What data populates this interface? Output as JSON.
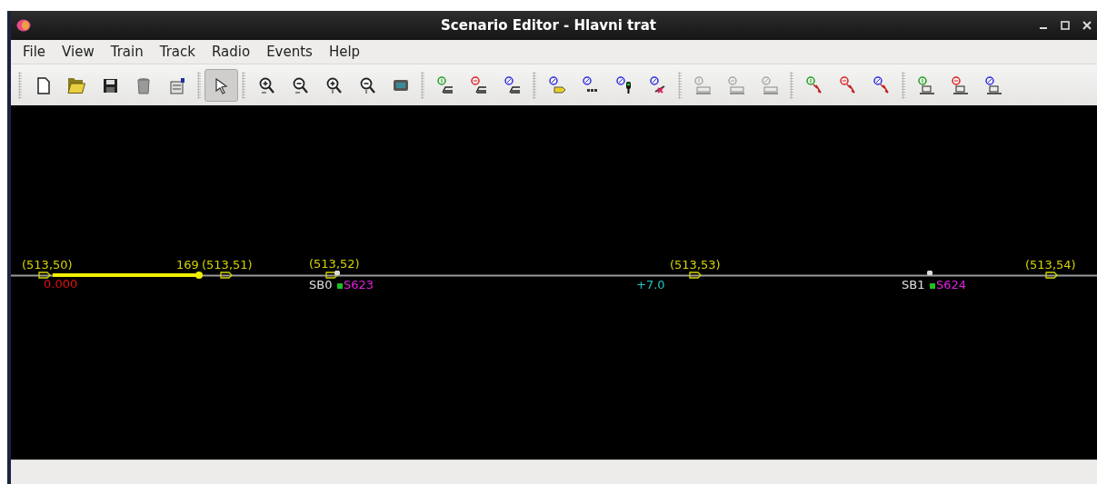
{
  "window": {
    "title": "Scenario Editor - Hlavni trat"
  },
  "menu": [
    "File",
    "View",
    "Train",
    "Track",
    "Radio",
    "Events",
    "Help"
  ],
  "toolbar": [
    {
      "tools": [
        {
          "kind": "new",
          "selected": false
        },
        {
          "kind": "open",
          "selected": false
        },
        {
          "kind": "save",
          "selected": false
        },
        {
          "kind": "delete",
          "selected": false
        },
        {
          "kind": "properties",
          "selected": false
        }
      ]
    },
    {
      "tools": [
        {
          "kind": "select",
          "selected": true
        }
      ]
    },
    {
      "tools": [
        {
          "kind": "zoom-in",
          "selected": false
        },
        {
          "kind": "zoom-out",
          "selected": false
        },
        {
          "kind": "zoom-in-vertical",
          "selected": false
        },
        {
          "kind": "zoom-out-vertical",
          "selected": false
        },
        {
          "kind": "overview",
          "selected": false
        }
      ]
    },
    {
      "tools": [
        {
          "kind": "train-add",
          "selected": false
        },
        {
          "kind": "train-remove",
          "selected": false
        },
        {
          "kind": "train-edit",
          "selected": false
        }
      ]
    },
    {
      "tools": [
        {
          "kind": "marker-tag",
          "selected": false
        },
        {
          "kind": "marker-dots",
          "selected": false
        },
        {
          "kind": "marker-signal",
          "selected": false
        },
        {
          "kind": "marker-stop",
          "selected": false
        }
      ]
    },
    {
      "tools": [
        {
          "kind": "object-add",
          "selected": false
        },
        {
          "kind": "object-remove",
          "selected": false
        },
        {
          "kind": "object-edit",
          "selected": false
        }
      ]
    },
    {
      "tools": [
        {
          "kind": "radio-add",
          "selected": false
        },
        {
          "kind": "radio-remove",
          "selected": false
        },
        {
          "kind": "radio-edit",
          "selected": false
        }
      ]
    },
    {
      "tools": [
        {
          "kind": "event-add",
          "selected": false
        },
        {
          "kind": "event-remove",
          "selected": false
        },
        {
          "kind": "event-edit",
          "selected": false
        }
      ]
    }
  ],
  "canvas": {
    "labels": [
      {
        "text": "(513,50)",
        "color": "#d4d400"
      },
      {
        "text": "169",
        "color": "#d4d400"
      },
      {
        "text": "(513,51)",
        "color": "#d4d400"
      },
      {
        "text": "(513,52)",
        "color": "#d4d400"
      },
      {
        "text": "(513,53)",
        "color": "#d4d400"
      },
      {
        "text": "(513,54)",
        "color": "#d4d400"
      },
      {
        "text": "0.000",
        "color": "#e01010"
      },
      {
        "text": "SB0",
        "color": "#e0e0e0"
      },
      {
        "text": "S623",
        "color": "#e020e0"
      },
      {
        "text": "+7.0",
        "color": "#20c8c8"
      },
      {
        "text": "SB1",
        "color": "#e0e0e0"
      },
      {
        "text": "S624",
        "color": "#e020e0"
      }
    ]
  }
}
